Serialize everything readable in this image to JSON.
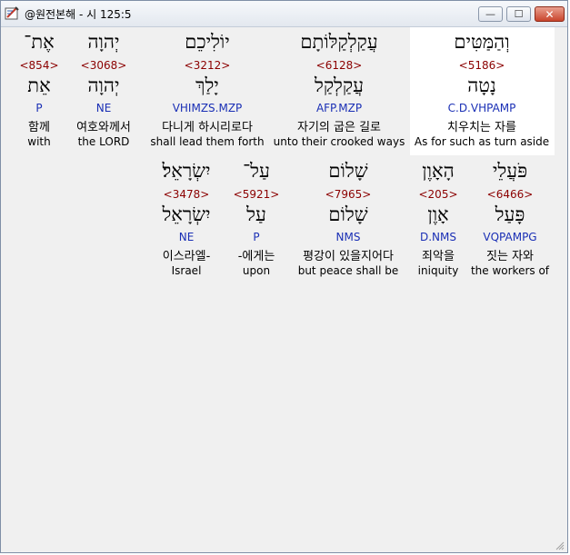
{
  "window": {
    "title": "@원전본해 - 시 125:5",
    "minimize_glyph": "—",
    "maximize_glyph": "☐",
    "close_glyph": "✕"
  },
  "words": [
    {
      "id": "w1",
      "hebrew": "וְהַמַּטִּים",
      "strong": "<5186>",
      "lemma": "נָטָה",
      "morph": "C.D.VHPAMP",
      "korean": "치우치는 자를",
      "english": "As for such as turn aside"
    },
    {
      "id": "w2",
      "hebrew": "עֲקַלְקַלּוֹתָם",
      "strong": "<6128>",
      "lemma": "עֲקַלְקַל",
      "morph": "AFP.MZP",
      "korean": "자기의 굽은 길로",
      "english": "unto their crooked ways"
    },
    {
      "id": "w3",
      "hebrew": "יוֹלִיכֵם",
      "strong": "<3212>",
      "lemma": "יָלַךְ",
      "morph": "VHIMZS.MZP",
      "korean": "다니게 하시리로다",
      "english": "shall lead them forth"
    },
    {
      "id": "w4",
      "hebrew": "יְהוָה",
      "strong": "<3068>",
      "lemma": "יְהוָה",
      "morph": "NE",
      "korean": "여호와께서",
      "english": "the LORD"
    },
    {
      "id": "w5",
      "hebrew": "אֶת־",
      "strong": "<854>",
      "lemma": "אֵת",
      "morph": "P",
      "korean": "함께",
      "english": "with"
    },
    {
      "id": "w6",
      "hebrew": "פֹּעֲלֵי",
      "strong": "<6466>",
      "lemma": "פָּעַל",
      "morph": "VQPAMPG",
      "korean": "짓는 자와",
      "english": "the workers of"
    },
    {
      "id": "w7",
      "hebrew": "הָאָוֶן",
      "strong": "<205>",
      "lemma": "אָוֶן",
      "morph": "D.NMS",
      "korean": "죄악을",
      "english": "iniquity"
    },
    {
      "id": "w8",
      "hebrew": "שָׁלוֹם",
      "strong": "<7965>",
      "lemma": "שָׁלוֹם",
      "morph": "NMS",
      "korean": "평강이 있을지어다",
      "english": "but peace shall be"
    },
    {
      "id": "w9",
      "hebrew": "עַל־",
      "strong": "<5921>",
      "lemma": "עַל",
      "morph": "P",
      "korean": "-에게는",
      "english": "upon"
    },
    {
      "id": "w10",
      "hebrew": "יִשְׂרָאֵל׃",
      "strong": "<3478>",
      "lemma": "יִשְׂרָאֵל",
      "morph": "NE",
      "korean": "이스라엘-",
      "english": "Israel"
    }
  ],
  "colors": {
    "strong": "#8b0000",
    "morph": "#1a2fb5",
    "highlight": "#ffffff"
  },
  "icons": {
    "app": "book-pen-icon",
    "resize": "resize-grip-icon"
  }
}
